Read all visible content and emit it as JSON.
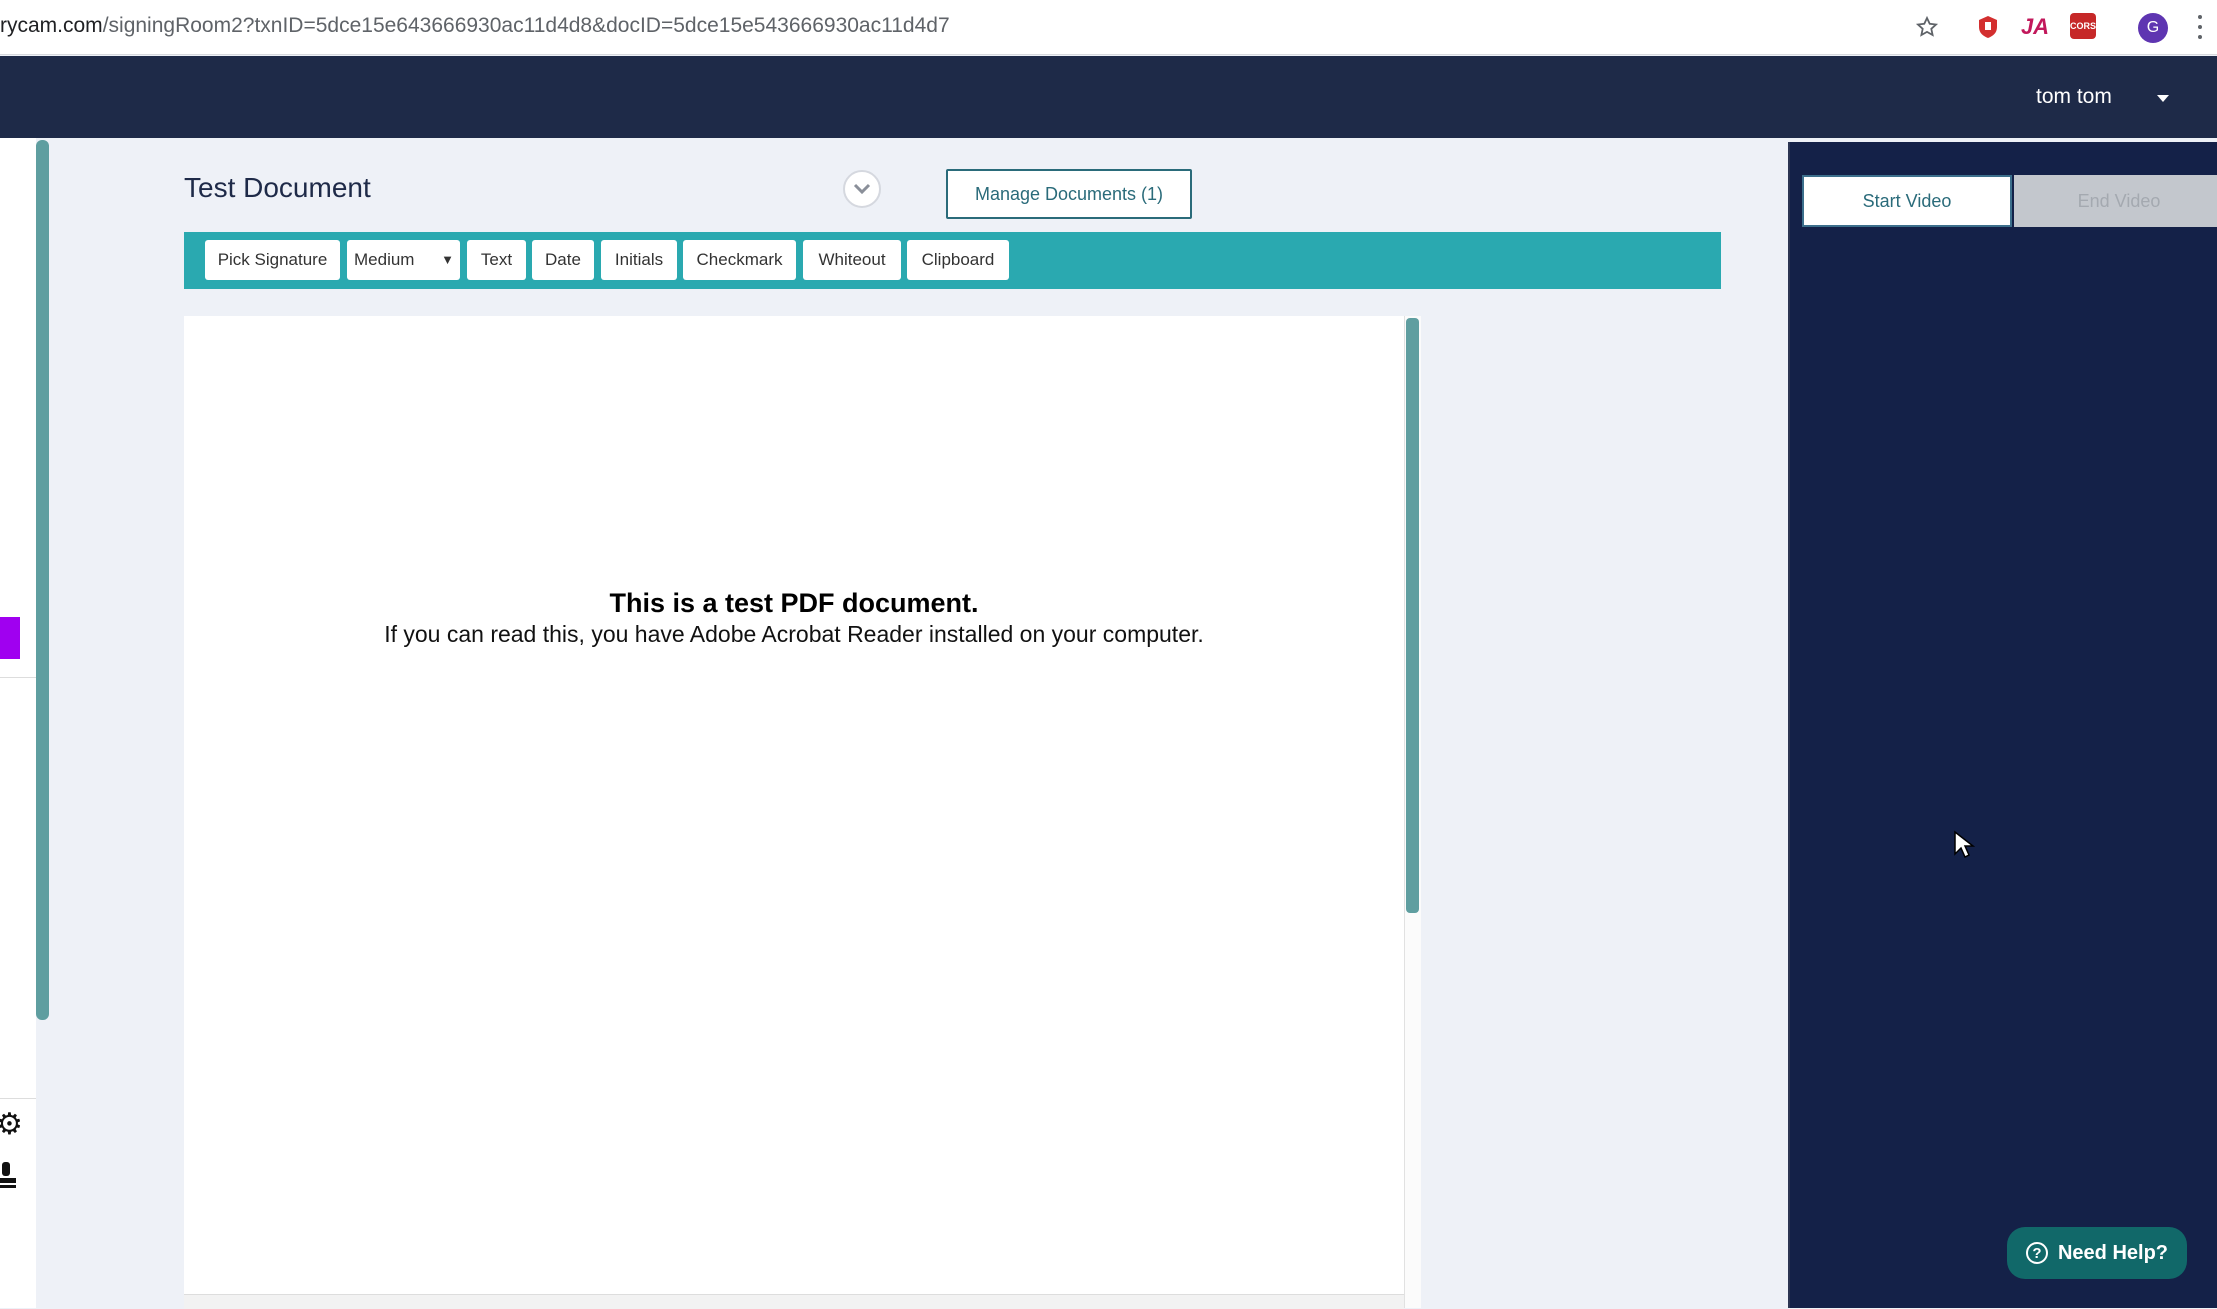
{
  "browser": {
    "url_host": "rycam.com",
    "url_path": "/signingRoom2?txnID=5dce15e643666930ac11d4d8&docID=5dce15e543666930ac11d4d7",
    "extensions": [
      "bookmark-star-icon",
      "shield-extension-icon",
      "ja-extension-icon",
      "cors-extension-icon"
    ],
    "cors_label": "CORS",
    "ja_label": "JA",
    "profile_initial": "G"
  },
  "header": {
    "user_name": "tom tom"
  },
  "document": {
    "title": "Test Document",
    "manage_label": "Manage Documents (1)"
  },
  "toolbar": {
    "pick_signature": "Pick Signature",
    "size_selected": "Medium",
    "text": "Text",
    "date": "Date",
    "initials": "Initials",
    "checkmark": "Checkmark",
    "whiteout": "Whiteout",
    "clipboard": "Clipboard"
  },
  "pdf": {
    "heading": "This is a test PDF document.",
    "body": "If you can read this, you have Adobe Acrobat Reader installed on your computer."
  },
  "video": {
    "start_label": "Start Video",
    "end_label": "End Video"
  },
  "help": {
    "label": "Need Help?"
  },
  "colors": {
    "header_bg": "#1e2a48",
    "toolbar_bg": "#2aa9b0",
    "panel_bg": "#142148",
    "accent_purple": "#a000f0",
    "help_bg": "#116869"
  }
}
